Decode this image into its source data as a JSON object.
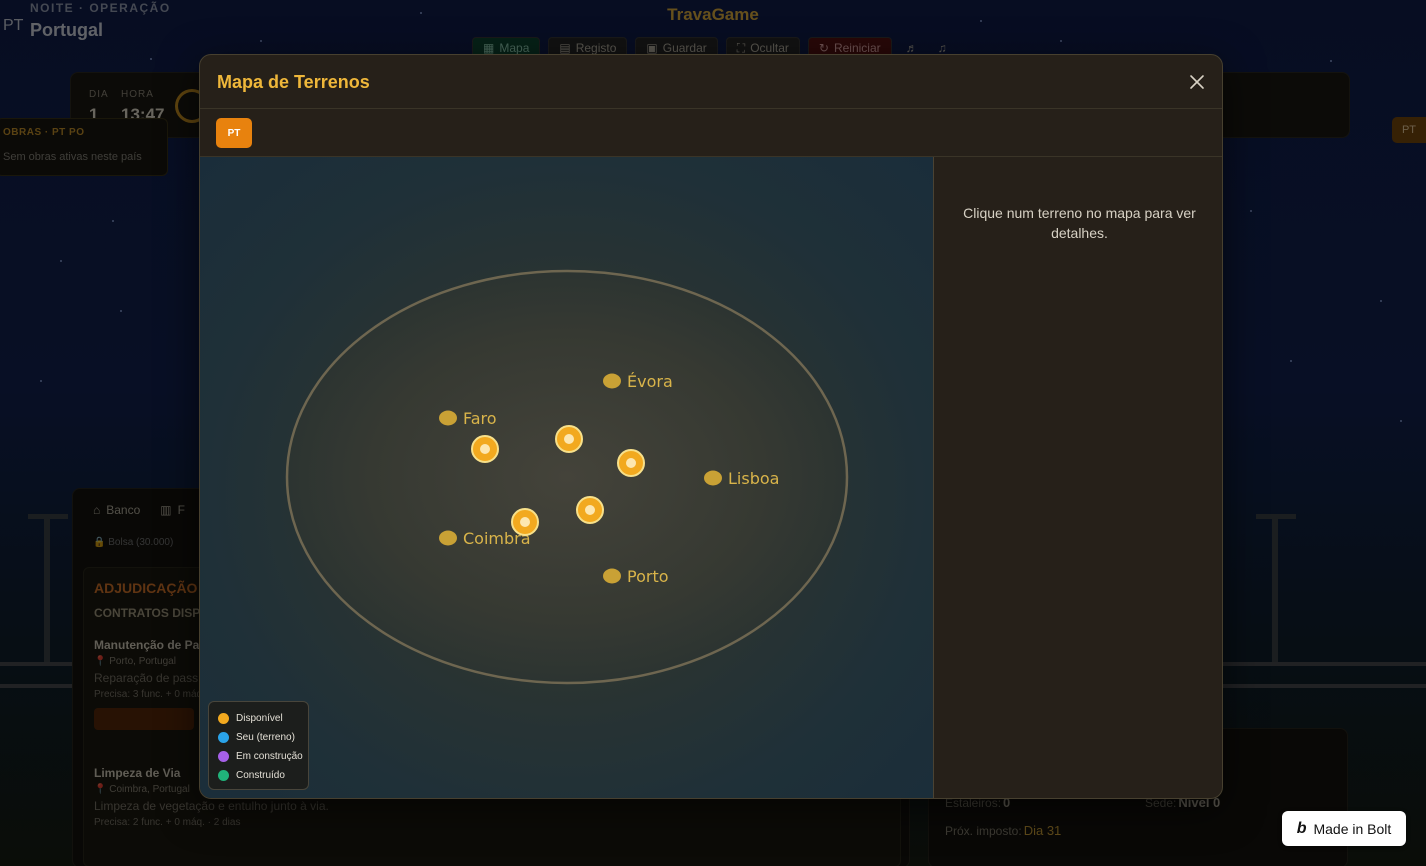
{
  "background": {
    "phase_label": "NOITE · OPERAÇÃO",
    "flag_code": "PT",
    "country": "Portugal",
    "game_title": "TravaGame",
    "nav": [
      {
        "icon": "map-icon",
        "label": "Mapa"
      },
      {
        "icon": "clipboard-icon",
        "label": "Registo"
      },
      {
        "icon": "save-icon",
        "label": "Guardar"
      },
      {
        "icon": "expand-icon",
        "label": "Ocultar"
      },
      {
        "icon": "refresh-icon",
        "label": "Reiniciar"
      },
      {
        "icon": "music-icon",
        "label": "♬"
      },
      {
        "icon": "music-icon",
        "label": "♫"
      }
    ],
    "clock": {
      "day_label": "DIA",
      "day": "1",
      "hour_label": "HORA",
      "hour": "13:47"
    },
    "works": {
      "title": "OBRAS · PT PO",
      "empty": "Sem obras ativas neste país"
    },
    "right_badge": "PT",
    "tabs": [
      {
        "icon": "bank-icon",
        "label": "Banco"
      },
      {
        "icon": "chart-icon",
        "label": "F"
      }
    ],
    "stock": "Bolsa (30.000)",
    "adjudication": {
      "title": "ADJUDICAÇÃO",
      "subtitle": "CONTRATOS DISPO",
      "contracts": [
        {
          "name": "Manutenção de Pa",
          "location": "Porto, Portugal",
          "description": "Reparação de pass",
          "meta": "Precisa: 3 func. + 0 máq."
        },
        {
          "name": "Limpeza de Via",
          "location": "Coimbra, Portugal",
          "description": "Limpeza de vegetação e entulho junto à via.",
          "meta": "Precisa: 2 func. + 0 máq. · 2 dias"
        }
      ]
    },
    "stats": {
      "yards_label": "Estaleiros:",
      "yards": "0",
      "hq_label": "Sede:",
      "hq": "Nível 0",
      "tax_label": "Próx. imposto:",
      "tax": "Dia 31"
    }
  },
  "modal": {
    "title": "Mapa de Terrenos",
    "close_icon": "close-icon",
    "country_tab": "PT",
    "hint": "Clique num terreno no mapa para ver detalhes.",
    "cities": [
      "Évora",
      "Faro",
      "Lisboa",
      "Coimbra",
      "Porto"
    ],
    "plots": [
      {
        "status": "Disponível"
      },
      {
        "status": "Disponível"
      },
      {
        "status": "Disponível"
      },
      {
        "status": "Disponível"
      },
      {
        "status": "Disponível"
      }
    ],
    "legend": [
      {
        "label": "Disponível",
        "color": "#f2a91f"
      },
      {
        "label": "Seu (terreno)",
        "color": "#2aa3e8"
      },
      {
        "label": "Em construção",
        "color": "#a660e8"
      },
      {
        "label": "Construído",
        "color": "#20b37a"
      }
    ]
  },
  "badge": {
    "label": "Made in Bolt",
    "mark": "b"
  }
}
